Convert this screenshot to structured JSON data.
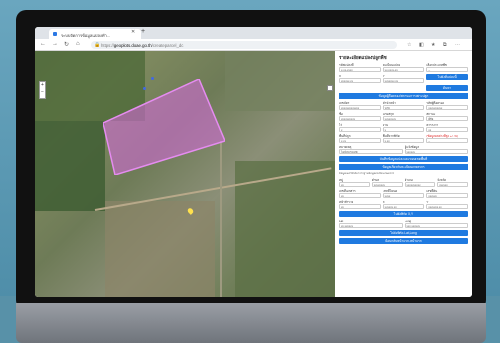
{
  "browser": {
    "tab_title": "ระบบจัดการข้อมูลแปลงทำ...",
    "url_prefix": "https://",
    "url_domain": "geoplots.doae.go.th",
    "url_path": "/createparcel_dc"
  },
  "panel": {
    "title": "รายละเอียดแปลงปลูกพืช",
    "row1": [
      {
        "label": "รหัสแปลงที่",
        "value": "x-xx-xxxx"
      },
      {
        "label": "ทะเบียนแปลง",
        "value": "xx-xxxx-xx"
      },
      {
        "label": "เลือกประเภทพืช",
        "value": "--"
      }
    ],
    "row2": [
      {
        "label": "X",
        "value": "xxxxxx.xx"
      },
      {
        "label": "Y",
        "value": "xxxxxxx.xx"
      }
    ],
    "btn_locate": "ไปยังที่แปลงนี้",
    "btn_search": "ค้นหา",
    "section1": "ข้อมูลผู้ถือครอง/สถานะการเพาะปลูก",
    "row3": [
      {
        "label": "เลขบัตร",
        "value": "xxxxxxxxxxxxx"
      },
      {
        "label": "คำนำหน้า",
        "value": "นาย"
      },
      {
        "label": "รหัสผู้ถือครอง",
        "value": "xxxxxxxxxx"
      }
    ],
    "row4": [
      {
        "label": "ชื่อ",
        "value": "xxxxxxxxxx"
      },
      {
        "label": "นามสกุล",
        "value": "xxxxxxxx"
      },
      {
        "label": "สถานะ",
        "value": "ผู้ถือ"
      }
    ],
    "row5": [
      {
        "label": "ไร่",
        "value": "x"
      },
      {
        "label": "งาน",
        "value": "x"
      },
      {
        "label": "ตารางวา",
        "value": "xx"
      }
    ],
    "row6": [
      {
        "label": "พื้นที่ปลูก",
        "value": "x.xx"
      },
      {
        "label": "พื้นที่จากพิกัด",
        "value": "x.xx"
      },
      {
        "label": "พื้นที่ผลต่าง",
        "value": "--"
      }
    ],
    "row6_red_label": "(ข้อมูลผลต่างที่สูง +/- %)",
    "row7": [
      {
        "label": "หมายเหตุ",
        "value": "ไม่มีหมายเหตุ"
      },
      {
        "label": "ผู้แจ้งข้อมูล",
        "value": "xxxxxx"
      }
    ],
    "btn_save": "บันทึกข้อมูลแปลงและขอบเขตพื้นที่",
    "section2": "ข้อมูลเกี่ยวกับทะเบียนเกษตรกร",
    "note": "ข้อมูลเหล่านี้ได้มาจากฐานข้อมูลทะเบียนเกษตรกร",
    "row8": [
      {
        "label": "หมู่",
        "value": "xx"
      },
      {
        "label": "ตำบล",
        "value": "xxxxxxxx"
      },
      {
        "label": "อำเภอ",
        "value": "xxxxxxxxxx"
      },
      {
        "label": "จังหวัด",
        "value": "xxxxxx"
      }
    ],
    "row9": [
      {
        "label": "เลขที่เอกสาร",
        "value": "xx"
      },
      {
        "label": "เลขที่โฉนด",
        "value": "xxxx"
      },
      {
        "label": "เลขที่ดิน",
        "value": "xxxxxx"
      }
    ],
    "row10": [
      {
        "label": "หน้าสำรวจ",
        "value": "xx"
      },
      {
        "label": "X",
        "value": "xxxxxx.xx"
      },
      {
        "label": "Y",
        "value": "xxxxxxx.xx"
      }
    ],
    "btn_xy": "ไปยังพิกัด X,Y",
    "row11": [
      {
        "label": "Lat",
        "value": "xx.xxxxxx"
      },
      {
        "label": "Long",
        "value": "xxx.xxxxxx"
      }
    ],
    "btn_latlong": "ไปยังพิกัด Lat,Long",
    "btn_back": "ย้อนกลับหน้าแรก-หน้าแรก"
  },
  "colors": {
    "primary": "#1f7ae0",
    "polygon": "#d06ad6"
  }
}
